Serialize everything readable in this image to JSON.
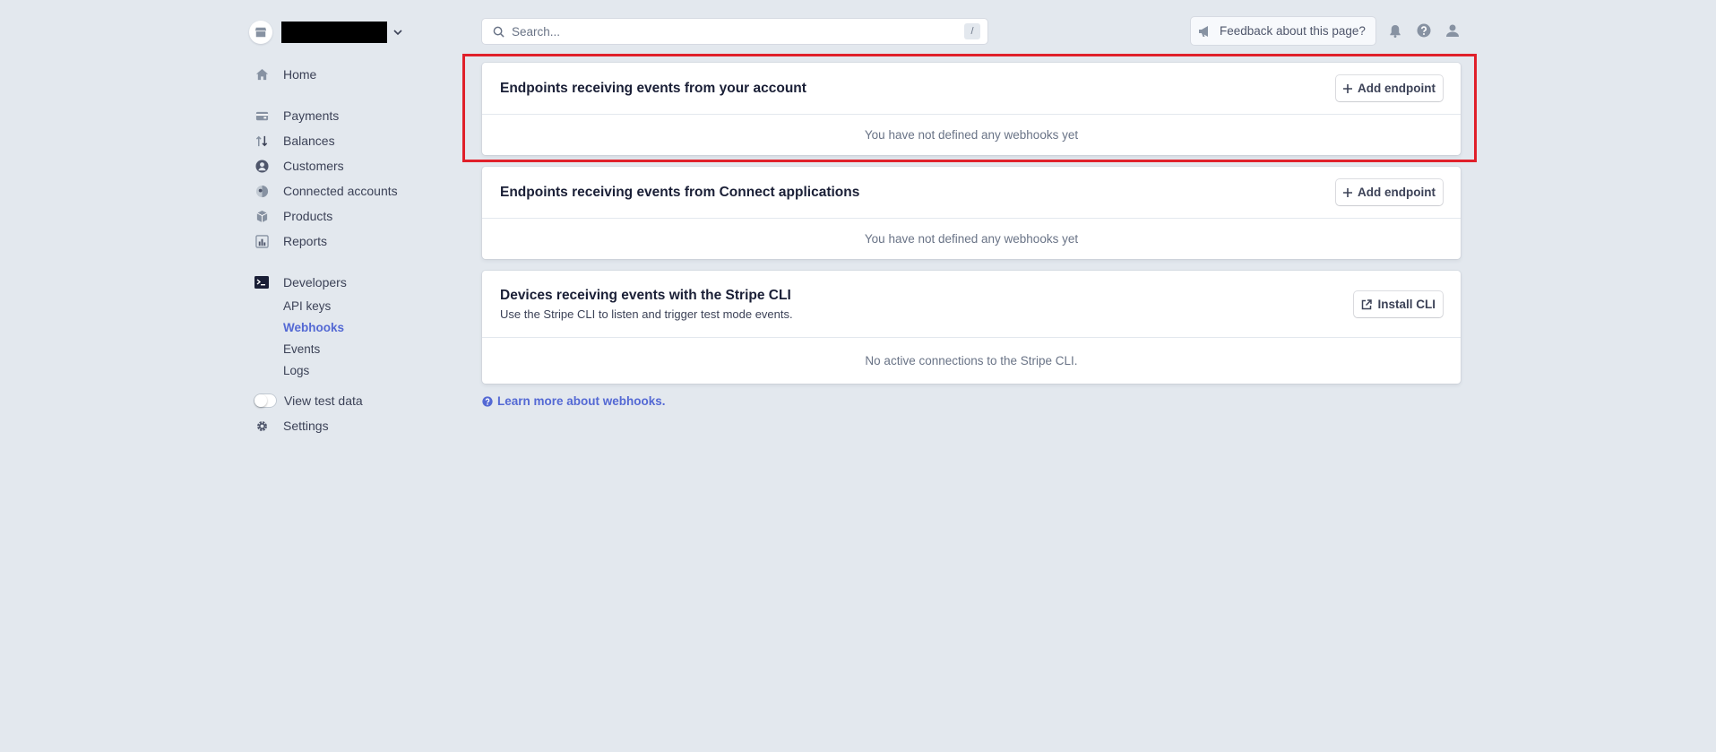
{
  "sidebar": {
    "account": {
      "name": "",
      "redacted": true
    },
    "primary": [
      {
        "label": "Home",
        "icon": "home-icon"
      }
    ],
    "main_items": [
      {
        "label": "Payments",
        "icon": "payments-icon"
      },
      {
        "label": "Balances",
        "icon": "balances-icon"
      },
      {
        "label": "Customers",
        "icon": "customers-icon"
      },
      {
        "label": "Connected accounts",
        "icon": "connected-accounts-icon"
      },
      {
        "label": "Products",
        "icon": "products-icon"
      },
      {
        "label": "Reports",
        "icon": "reports-icon"
      }
    ],
    "developers": {
      "label": "Developers",
      "icon": "terminal-icon",
      "items": [
        {
          "label": "API keys",
          "active": false
        },
        {
          "label": "Webhooks",
          "active": true
        },
        {
          "label": "Events",
          "active": false
        },
        {
          "label": "Logs",
          "active": false
        }
      ]
    },
    "test_data": {
      "label": "View test data",
      "enabled": false
    },
    "settings": {
      "label": "Settings",
      "icon": "gear-icon"
    }
  },
  "topbar": {
    "search": {
      "placeholder": "Search...",
      "value": "",
      "shortcut": "/"
    },
    "feedback_label": "Feedback about this page?",
    "icons": [
      "bell-icon",
      "help-icon",
      "user-icon"
    ]
  },
  "cards": [
    {
      "title": "Endpoints receiving events from your account",
      "subtitle": "",
      "button": {
        "label": "Add endpoint",
        "icon": "plus-icon"
      },
      "empty_message": "You have not defined any webhooks yet",
      "highlighted": true
    },
    {
      "title": "Endpoints receiving events from Connect applications",
      "subtitle": "",
      "button": {
        "label": "Add endpoint",
        "icon": "plus-icon"
      },
      "empty_message": "You have not defined any webhooks yet",
      "highlighted": false
    },
    {
      "title": "Devices receiving events with the Stripe CLI",
      "subtitle": "Use the Stripe CLI to listen and trigger test mode events.",
      "button": {
        "label": "Install CLI",
        "icon": "external-link-icon"
      },
      "empty_message": "No active connections to the Stripe CLI.",
      "highlighted": false
    }
  ],
  "learn_more": {
    "label": "Learn more about webhooks.",
    "icon": "help-circle-icon"
  },
  "colors": {
    "background": "#e3e8ee",
    "accent": "#5469d4",
    "highlight": "#e0202a",
    "text": "#3c4257"
  }
}
